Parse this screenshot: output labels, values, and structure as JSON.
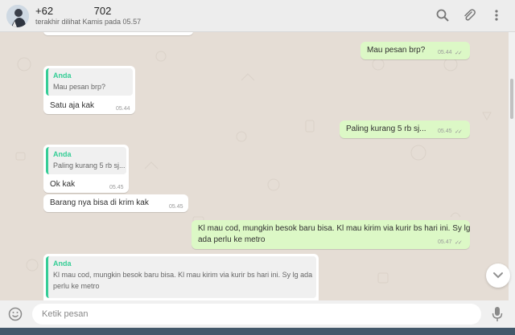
{
  "header": {
    "contact_name": "+62              702",
    "last_seen": "terakhir dilihat Kamis pada 05.57",
    "icons": [
      "search-icon",
      "attach-icon",
      "menu-icon"
    ]
  },
  "messages": [
    {
      "direction": "out",
      "text": "Mau pesan brp?",
      "time": "05.44",
      "status": "read"
    },
    {
      "direction": "in",
      "quote": {
        "author": "Anda",
        "text": "Mau pesan brp?"
      },
      "text": "Satu aja kak",
      "time": "05.44"
    },
    {
      "direction": "out",
      "text": "Paling kurang 5 rb sj...",
      "time": "05.45",
      "status": "read"
    },
    {
      "direction": "in",
      "quote": {
        "author": "Anda",
        "text": "Paling kurang 5 rb sj..."
      },
      "text": "Ok kak",
      "time": "05.45"
    },
    {
      "direction": "in",
      "text": "Barang nya bisa di krim kak",
      "time": "05.45"
    },
    {
      "direction": "out",
      "text_line1": "Kl mau cod, mungkin besok baru bisa. Kl mau kirim via kurir bs hari ini. Sy lg",
      "text_line2": "ada perlu ke metro",
      "time": "05.47",
      "status": "read"
    },
    {
      "direction": "in",
      "quote": {
        "author": "Anda",
        "text_line1": "Kl mau cod, mungkin besok baru bisa. Kl mau kirim via kurir bs hari ini. Sy lg ada",
        "text_line2": "perlu ke metro"
      }
    }
  ],
  "footer": {
    "input_placeholder": "Ketik pesan",
    "icons": [
      "emoji-icon",
      "mic-icon"
    ]
  },
  "colors": {
    "chat_bg": "#e5ddd5",
    "outgoing_bubble": "#dcf8c6",
    "incoming_bubble": "#ffffff",
    "quote_accent": "#35cd96",
    "header_bg": "#ededed"
  }
}
